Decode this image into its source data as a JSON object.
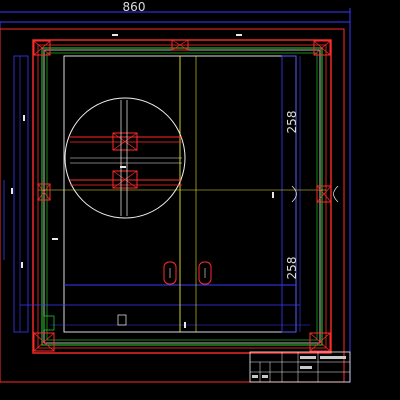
{
  "drawing": {
    "dimensions": {
      "overall_width": "860",
      "upper_half_height": "258",
      "lower_half_height": "258"
    },
    "colors": {
      "background": "#000000",
      "frame_red": "#ff2a2a",
      "frame_green": "#23c223",
      "line_blue": "#3a3aff",
      "line_yellow": "#e6e62e",
      "line_white": "#f2f2f2",
      "line_cyan": "#2ad4d4"
    }
  }
}
